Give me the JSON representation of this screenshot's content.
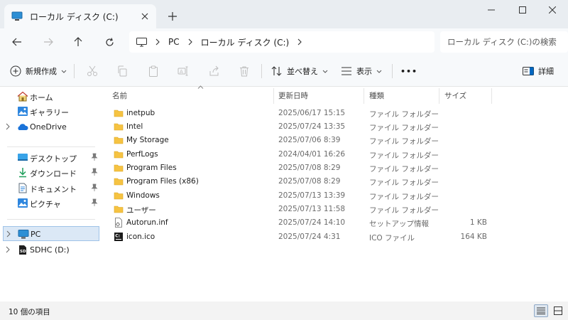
{
  "window": {
    "tab_title": "ローカル ディスク (C:)",
    "tab_icon": "monitor-icon",
    "accent": "#0067c0"
  },
  "address": {
    "crumbs": [
      "PC",
      "ローカル ディスク (C:)"
    ],
    "search_placeholder": "ローカル ディスク (C:)の検索"
  },
  "command_bar": {
    "new_label": "新規作成",
    "sort_label": "並べ替え",
    "view_label": "表示",
    "details_label": "詳細",
    "more_label": "•••"
  },
  "nav": {
    "items": [
      {
        "label": "ホーム",
        "icon": "home-icon"
      },
      {
        "label": "ギャラリー",
        "icon": "gallery-icon"
      },
      {
        "label": "OneDrive",
        "icon": "onedrive-icon"
      },
      {
        "label": "デスクトップ",
        "icon": "desktop-folder-icon"
      },
      {
        "label": "ダウンロード",
        "icon": "download-icon"
      },
      {
        "label": "ドキュメント",
        "icon": "document-icon"
      },
      {
        "label": "ピクチャ",
        "icon": "picture-icon"
      },
      {
        "label": "PC",
        "icon": "pc-icon"
      },
      {
        "label": "SDHC (D:)",
        "icon": "sd-card-icon"
      }
    ]
  },
  "columns": {
    "name": "名前",
    "date": "更新日時",
    "type": "種類",
    "size": "サイズ"
  },
  "files": [
    {
      "name": "inetpub",
      "date": "2025/06/17 15:15",
      "type": "ファイル フォルダー",
      "size": "",
      "icon": "folder-icon"
    },
    {
      "name": "Intel",
      "date": "2025/07/24 13:35",
      "type": "ファイル フォルダー",
      "size": "",
      "icon": "folder-icon"
    },
    {
      "name": "My Storage",
      "date": "2025/07/06 8:39",
      "type": "ファイル フォルダー",
      "size": "",
      "icon": "folder-icon"
    },
    {
      "name": "PerfLogs",
      "date": "2024/04/01 16:26",
      "type": "ファイル フォルダー",
      "size": "",
      "icon": "folder-icon"
    },
    {
      "name": "Program Files",
      "date": "2025/07/08 8:29",
      "type": "ファイル フォルダー",
      "size": "",
      "icon": "folder-icon"
    },
    {
      "name": "Program Files (x86)",
      "date": "2025/07/08 8:29",
      "type": "ファイル フォルダー",
      "size": "",
      "icon": "folder-icon"
    },
    {
      "name": "Windows",
      "date": "2025/07/13 13:39",
      "type": "ファイル フォルダー",
      "size": "",
      "icon": "folder-icon"
    },
    {
      "name": "ユーザー",
      "date": "2025/07/13 11:58",
      "type": "ファイル フォルダー",
      "size": "",
      "icon": "folder-icon"
    },
    {
      "name": "Autorun.inf",
      "date": "2025/07/24 14:10",
      "type": "セットアップ情報",
      "size": "1 KB",
      "icon": "settings-file-icon"
    },
    {
      "name": "icon.ico",
      "date": "2025/07/24 4:31",
      "type": "ICO ファイル",
      "size": "164 KB",
      "icon": "ico-file-icon"
    }
  ],
  "status": {
    "item_count": "10 個の項目"
  }
}
